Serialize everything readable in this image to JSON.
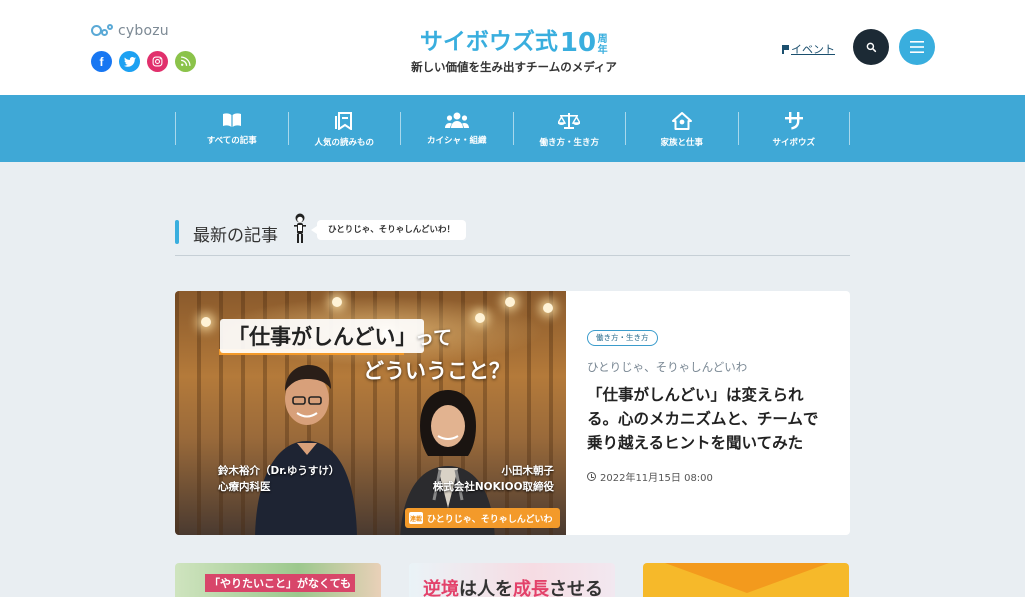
{
  "header": {
    "cybozu_logo": "cybozu",
    "brand_title": "サイボウズ式",
    "brand_ten": "10",
    "brand_anniv": "周年",
    "brand_sub": "新しい価値を生み出すチームのメディア",
    "event_link": "イベント",
    "social": [
      "facebook-icon",
      "twitter-icon",
      "instagram-icon",
      "rss-icon"
    ],
    "accent": "#39aede"
  },
  "nav": {
    "items": [
      {
        "icon": "book-icon",
        "label": "すべての記事"
      },
      {
        "icon": "bookmark-icon",
        "label": "人気の読みもの"
      },
      {
        "icon": "people-icon",
        "label": "カイシャ・組織"
      },
      {
        "icon": "scale-icon",
        "label": "働き方・生き方"
      },
      {
        "icon": "house-icon",
        "label": "家族と仕事"
      },
      {
        "icon": "cybozu-sa-icon",
        "label": "サイボウズ"
      }
    ]
  },
  "section": {
    "title": "最新の記事",
    "bubble": "ひとりじゃ、そりゃしんどいわ！"
  },
  "featured": {
    "image_text": {
      "headline_quote": "「仕事がしんどい」",
      "headline_tte": "って",
      "headline_rest": "どういうこと？",
      "person1_name": "鈴木裕介（Dr.ゆうすけ）",
      "person1_title": "心療内科医",
      "person2_name": "小田木朝子",
      "person2_title": "株式会社NOKIOO取締役",
      "badge_mark": "連載",
      "badge_label": "ひとりじゃ、そりゃしんどいわ"
    },
    "tag": "働き方・生き方",
    "series": "ひとりじゃ、そりゃしんどいわ",
    "title": "「仕事がしんどい」は変えられる。心のメカニズムと、チームで乗り越えるヒントを聞いてみた",
    "date": "2022年11月15日 08:00"
  },
  "cards": [
    {
      "text": "「やりたいこと」がなくても"
    },
    {
      "part1": "逆境",
      "part2": "は人を",
      "part3": "成長",
      "part4": "させる"
    },
    {
      "text": ""
    }
  ]
}
